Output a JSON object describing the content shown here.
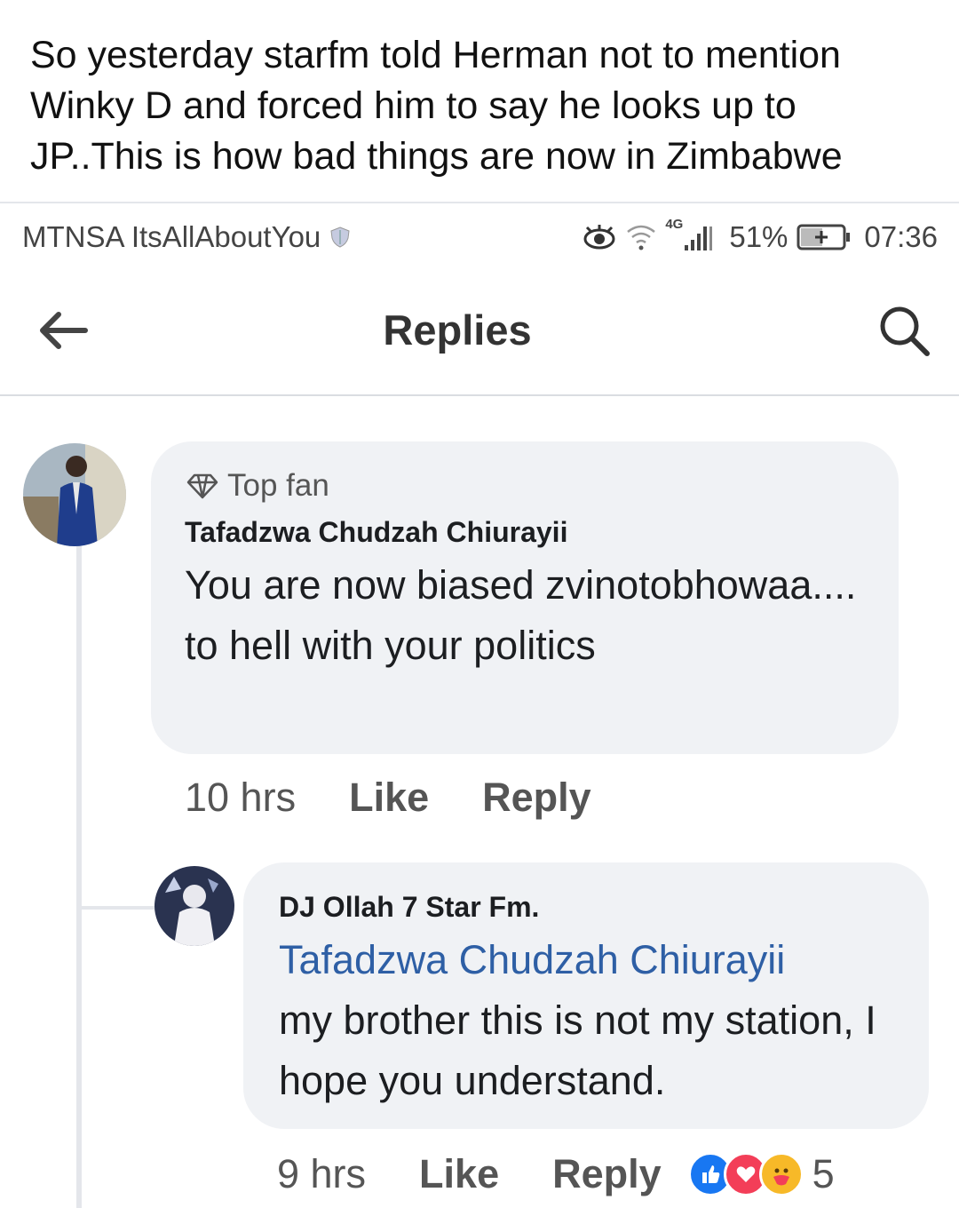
{
  "caption": "So yesterday starfm told Herman not to mention Winky D and forced him to say he looks up to JP..This is how bad things are now in Zimbabwe",
  "status_bar": {
    "carrier": "MTNSA ItsAllAboutYou",
    "network": "4G",
    "battery": "51%",
    "time": "07:36"
  },
  "header": {
    "title": "Replies",
    "back_icon": "back-arrow-icon",
    "search_icon": "search-icon"
  },
  "comments": [
    {
      "badge": "Top fan",
      "author": "Tafadzwa Chudzah Chiurayii",
      "text": "You are now biased zvinotobhowaa.... to hell with your politics",
      "time": "10 hrs",
      "like": "Like",
      "reply": "Reply"
    },
    {
      "author": "DJ Ollah 7 Star Fm.",
      "mention": "Tafadzwa Chudzah Chiurayii",
      "text": "my brother this is not my station, I hope you understand.",
      "time": "9 hrs",
      "like": "Like",
      "reply": "Reply",
      "reaction_count": "5",
      "reactions": [
        "like-reaction-icon",
        "love-reaction-icon",
        "care-reaction-icon"
      ]
    }
  ],
  "colors": {
    "bubble": "#f0f2f5",
    "mention": "#2e5fa5",
    "like_reaction": "#1877f2",
    "love_reaction": "#f33e58",
    "care_reaction": "#f7b928"
  }
}
